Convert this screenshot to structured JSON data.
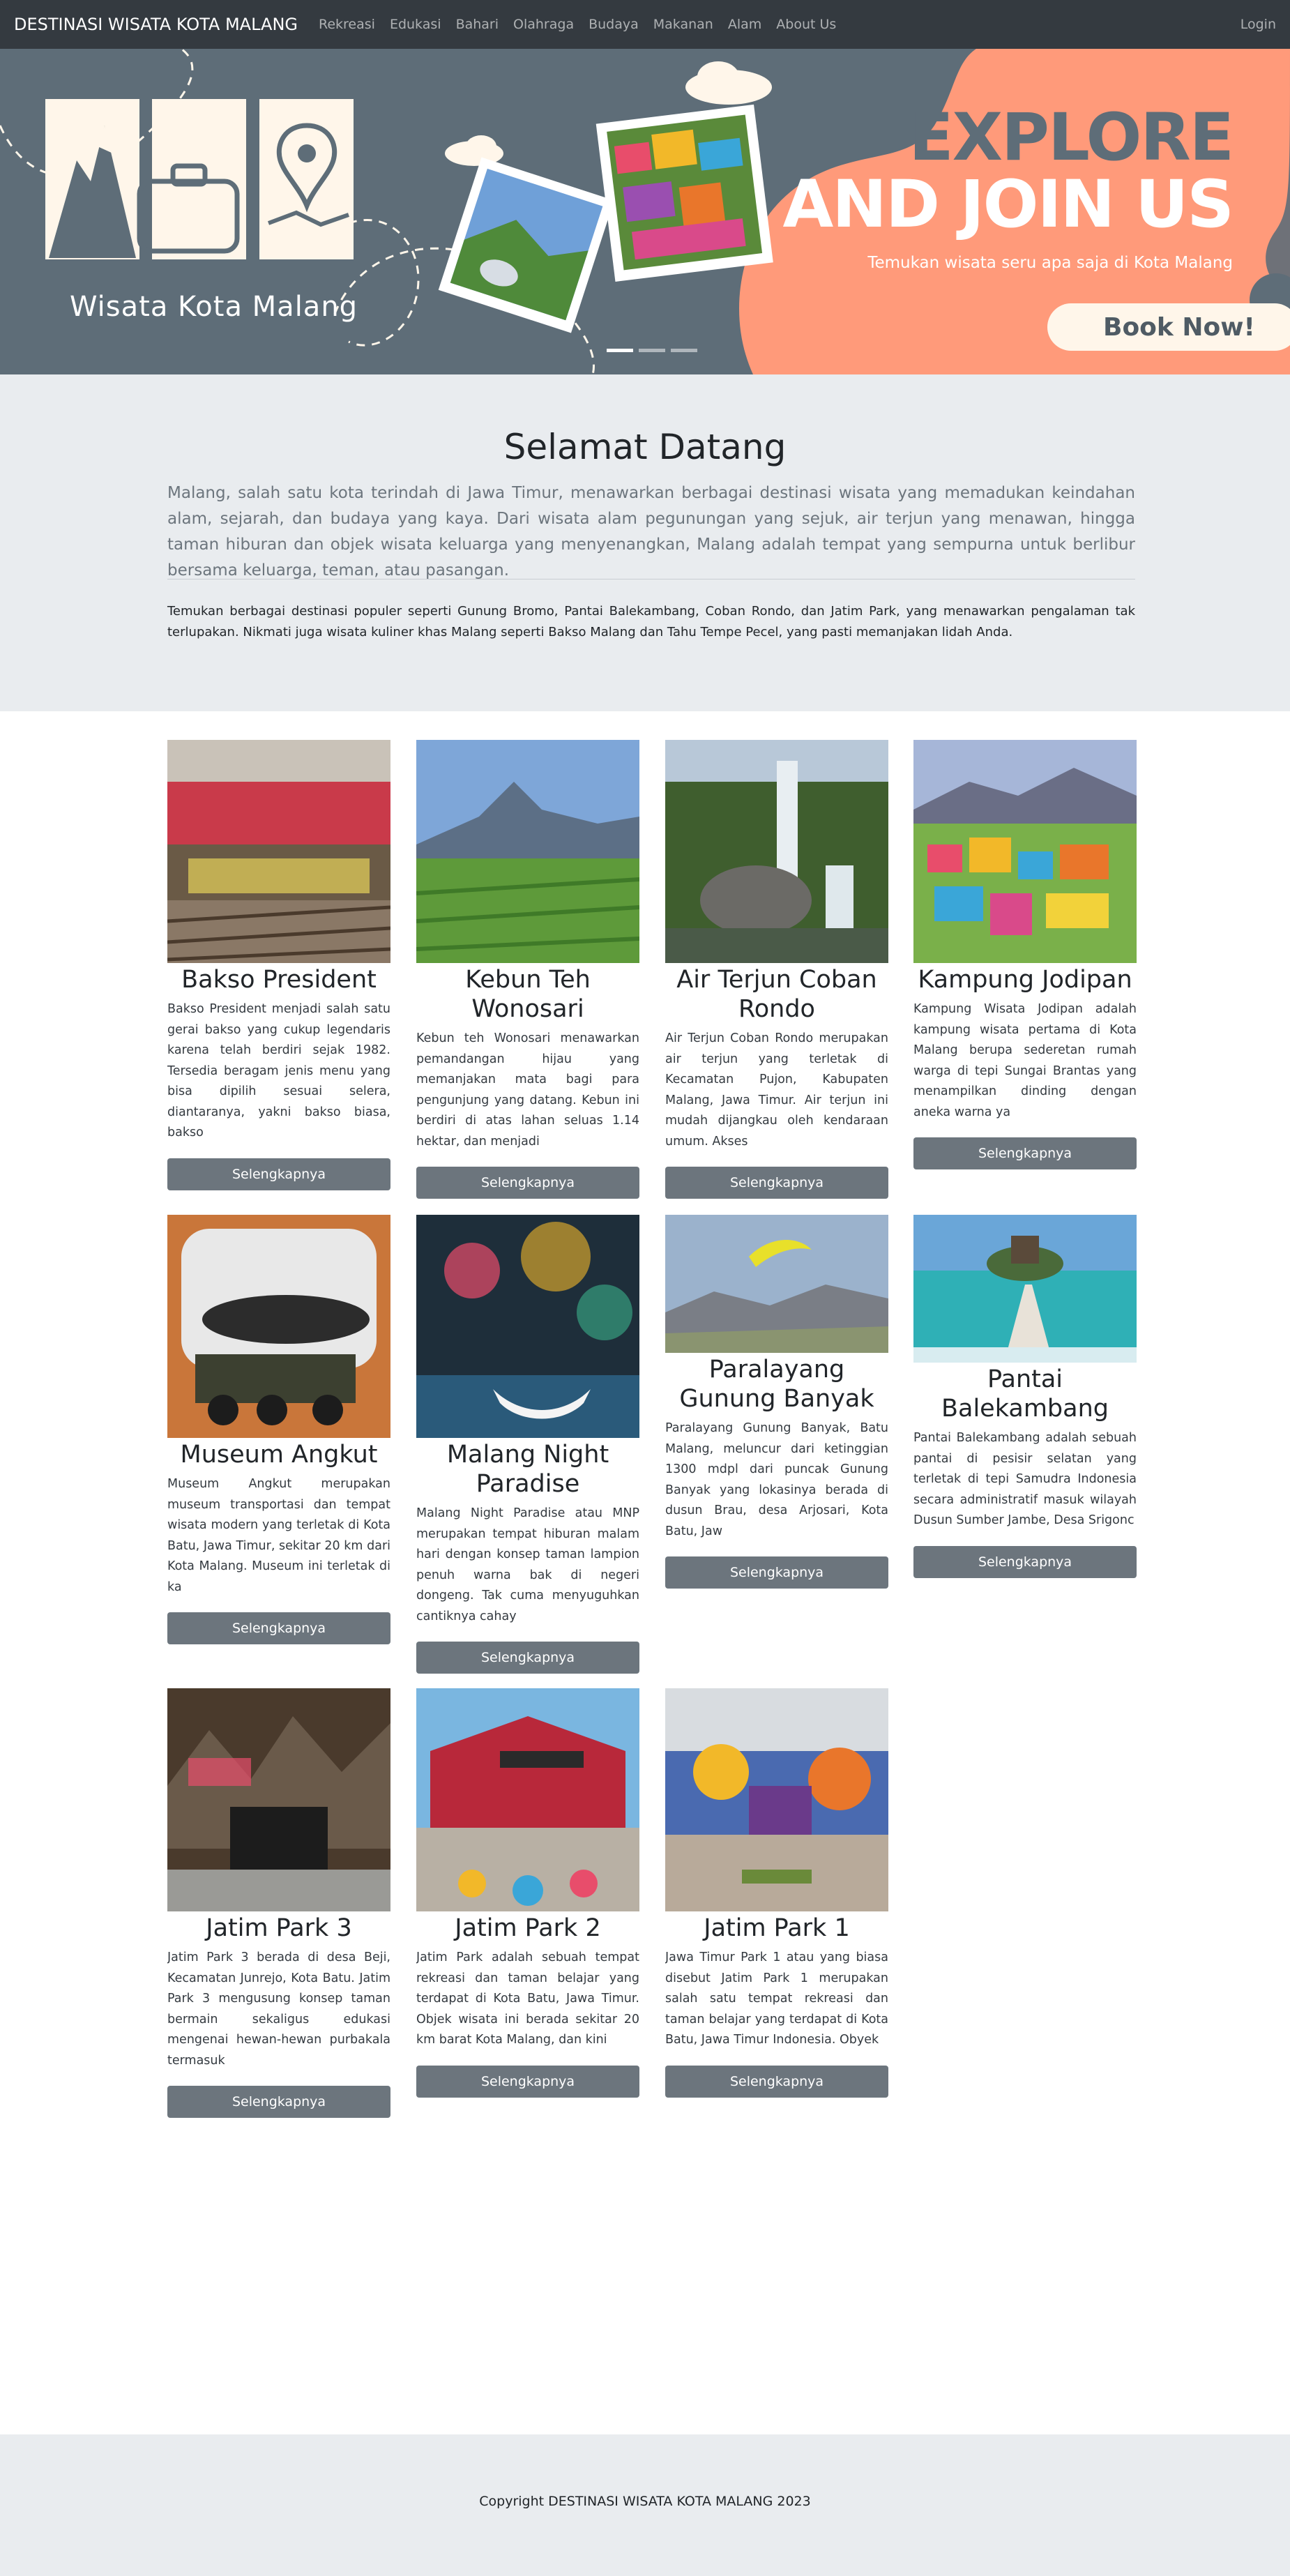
{
  "navbar": {
    "brand": "DESTINASI WISATA KOTA MALANG",
    "links": [
      "Rekreasi",
      "Edukasi",
      "Bahari",
      "Olahraga",
      "Budaya",
      "Makanan",
      "Alam",
      "About Us"
    ],
    "login": "Login"
  },
  "hero": {
    "logo_text": "Wisata Kota Malang",
    "title_line1": "EXPLORE",
    "title_line2": "AND JOIN US",
    "subtitle": "Temukan wisata seru apa saja di Kota Malang",
    "button": "Book Now!",
    "slide_count": 3,
    "active_slide": 1,
    "colors": {
      "background": "#5e6d78",
      "accent": "#ff9a7a",
      "cream": "#fff6ea"
    }
  },
  "welcome": {
    "title": "Selamat Datang",
    "lead": "Malang, salah satu kota terindah di Jawa Timur, menawarkan berbagai destinasi wisata yang memadukan keindahan alam, sejarah, dan budaya yang kaya. Dari wisata alam pegunungan yang sejuk, air terjun yang menawan, hingga taman hiburan dan objek wisata keluarga yang menyenangkan, Malang adalah tempat yang sempurna untuk berlibur bersama keluarga, teman, atau pasangan.",
    "description": "Temukan berbagai destinasi populer seperti Gunung Bromo, Pantai Balekambang, Coban Rondo, dan Jatim Park, yang menawarkan pengalaman tak terlupakan. Nikmati juga wisata kuliner khas Malang seperti Bakso Malang dan Tahu Tempe Pecel, yang pasti memanjakan lidah Anda."
  },
  "cards": [
    {
      "title": "Bakso President",
      "text": "Bakso President menjadi salah satu gerai bakso yang cukup legendaris karena telah berdiri sejak 1982. Tersedia beragam jenis menu yang bisa dipilih sesuai selera, diantaranya, yakni bakso biasa, bakso",
      "button": "Selengkapnya"
    },
    {
      "title": "Kebun Teh Wonosari",
      "text": "Kebun teh Wonosari menawarkan pemandangan hijau yang memanjakan mata bagi para pengunjung yang datang. Kebun ini berdiri di atas lahan seluas 1.14 hektar, dan menjadi",
      "button": "Selengkapnya"
    },
    {
      "title": "Air Terjun Coban Rondo",
      "text": "Air Terjun Coban Rondo merupakan air terjun yang terletak di Kecamatan Pujon, Kabupaten Malang, Jawa Timur. Air terjun ini mudah dijangkau oleh kendaraan umum. Akses",
      "button": "Selengkapnya"
    },
    {
      "title": "Kampung Jodipan",
      "text": "Kampung Wisata Jodipan adalah kampung wisata pertama di Kota Malang berupa sederetan rumah warga di tepi Sungai Brantas yang menampilkan dinding dengan aneka warna ya",
      "button": "Selengkapnya"
    },
    {
      "title": "Museum Angkut",
      "text": "Museum Angkut merupakan museum transportasi dan tempat wisata modern yang terletak di Kota Batu, Jawa Timur, sekitar 20 km dari Kota Malang. Museum ini terletak di ka",
      "button": "Selengkapnya"
    },
    {
      "title": "Malang Night Paradise",
      "text": "Malang Night Paradise atau MNP merupakan tempat hiburan malam hari dengan konsep taman lampion penuh warna bak di negeri dongeng. Tak cuma menyuguhkan cantiknya cahay",
      "button": "Selengkapnya"
    },
    {
      "title": "Paralayang Gunung Banyak",
      "text": "Paralayang Gunung Banyak, Batu Malang, meluncur dari ketinggian 1300 mdpl dari puncak Gunung Banyak yang lokasinya berada di dusun Brau, desa Arjosari, Kota Batu, Jaw",
      "button": "Selengkapnya"
    },
    {
      "title": "Pantai Balekambang",
      "text": "Pantai Balekambang adalah sebuah pantai di pesisir selatan yang terletak di tepi Samudra Indonesia secara administratif masuk wilayah Dusun Sumber Jambe, Desa Srigonc",
      "button": "Selengkapnya"
    },
    {
      "title": "Jatim Park 3",
      "text": "Jatim Park 3 berada di desa Beji, Kecamatan Junrejo, Kota Batu. Jatim Park 3 mengusung konsep taman bermain sekaligus edukasi mengenai hewan-hewan purbakala termasuk",
      "button": "Selengkapnya"
    },
    {
      "title": "Jatim Park 2",
      "text": "Jatim Park adalah sebuah tempat rekreasi dan taman belajar yang terdapat di Kota Batu, Jawa Timur. Objek wisata ini berada sekitar 20 km barat Kota Malang, dan kini",
      "button": "Selengkapnya"
    },
    {
      "title": "Jatim Park 1",
      "text": "Jawa Timur Park 1 atau yang biasa disebut Jatim Park 1 merupakan salah satu tempat rekreasi dan taman belajar yang terdapat di Kota Batu, Jawa Timur Indonesia. Obyek",
      "button": "Selengkapnya"
    }
  ],
  "footer": {
    "copyright": "Copyright DESTINASI WISATA KOTA MALANG 2023"
  }
}
